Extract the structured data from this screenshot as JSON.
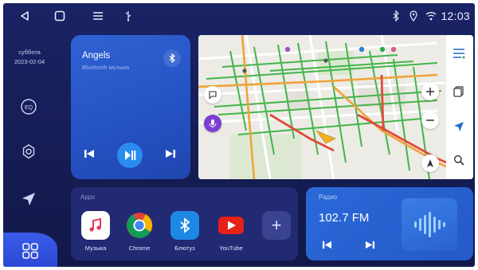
{
  "statusbar": {
    "clock": "12:03",
    "icons": [
      "back-icon",
      "home-icon",
      "menu-icon",
      "usb-icon",
      "bluetooth-icon",
      "location-icon",
      "wifi-icon"
    ]
  },
  "sidebar": {
    "day": "суббота",
    "date": "2023-02-04",
    "buttons": [
      "eq-icon",
      "settings-icon",
      "navigation-icon",
      "apps-grid-icon"
    ],
    "eq_label": "EQ"
  },
  "music": {
    "title": "Angels",
    "source": "Bluetooth музыка"
  },
  "map": {
    "buttons": [
      "layers-icon",
      "voice-icon",
      "mic-icon",
      "zoom-in-icon",
      "zoom-out-icon",
      "locate-icon",
      "compass-icon",
      "search-icon",
      "menu-icon",
      "bookmark-icon"
    ]
  },
  "apps": {
    "label": "Apps",
    "items": [
      {
        "name": "Музыка",
        "icon": "music-note-icon",
        "color": "#ffffff"
      },
      {
        "name": "Chrome",
        "icon": "chrome-icon",
        "color": "#ffffff"
      },
      {
        "name": "Блютуз",
        "icon": "bluetooth-icon",
        "color": "#1e88e5"
      },
      {
        "name": "YouTube",
        "icon": "youtube-icon",
        "color": "#e62117"
      }
    ],
    "add_label": "+"
  },
  "radio": {
    "label": "Радио",
    "frequency": "102.7 FM"
  }
}
